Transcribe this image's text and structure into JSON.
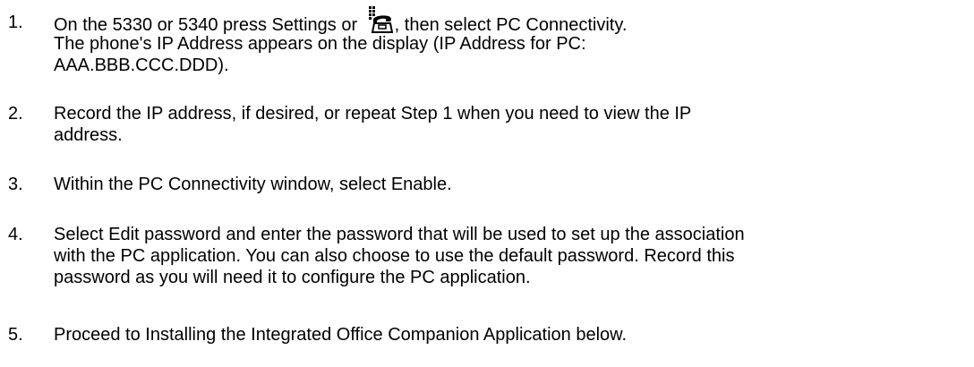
{
  "steps": [
    {
      "number": "1.",
      "lines": [
        "The phone's IP Address appears on the display (IP Address for PC:",
        "AAA.BBB.CCC.DDD)."
      ],
      "lead_before_icon": "On the 5330 or 5340 press Settings or ",
      "lead_after_icon": ", then select PC Connectivity.",
      "icon": "settings-phone-icon"
    },
    {
      "number": "2.",
      "lines": [
        "Record the IP address, if desired, or repeat Step 1 when you need to view the IP",
        "address."
      ]
    },
    {
      "number": "3.",
      "lines": [
        "Within the PC Connectivity window, select Enable."
      ]
    },
    {
      "number": "4.",
      "lines": [
        "Select Edit password and enter the password that will be used to set up the association",
        "with the PC application. You can also choose to use the default password. Record this",
        "password as you will need it to configure the PC application."
      ]
    },
    {
      "number": "5.",
      "lines": [
        "Proceed to Installing the Integrated Office Companion Application below."
      ]
    }
  ]
}
